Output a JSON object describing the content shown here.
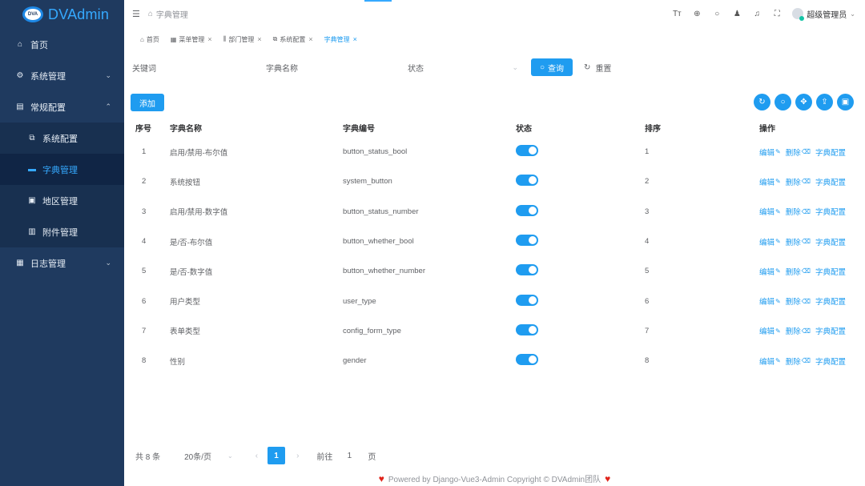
{
  "app": {
    "logo_badge": "DVA",
    "name": "DVAdmin"
  },
  "sidebar": {
    "items": [
      {
        "label": "首页",
        "icon": "home-icon",
        "glyph": "⌂",
        "level": 1
      },
      {
        "label": "系统管理",
        "icon": "gear-icon",
        "glyph": "⚙",
        "level": 1,
        "arrow": "⌄"
      },
      {
        "label": "常规配置",
        "icon": "config-icon",
        "glyph": "▤",
        "level": 1,
        "arrow": "⌃"
      },
      {
        "label": "系统配置",
        "icon": "system-config-icon",
        "glyph": "⧉",
        "level": 2
      },
      {
        "label": "字典管理",
        "icon": "dictionary-icon",
        "glyph": "▬",
        "level": 2,
        "active": true
      },
      {
        "label": "地区管理",
        "icon": "region-icon",
        "glyph": "▣",
        "level": 2
      },
      {
        "label": "附件管理",
        "icon": "attachment-icon",
        "glyph": "▥",
        "level": 2
      },
      {
        "label": "日志管理",
        "icon": "log-icon",
        "glyph": "▦",
        "level": 1,
        "arrow": "⌄"
      }
    ]
  },
  "header": {
    "breadcrumb": "字典管理",
    "user_name": "超级管理员",
    "icons": [
      "font-size-icon",
      "language-icon",
      "search-icon",
      "theme-icon",
      "notification-icon",
      "fullscreen-icon"
    ]
  },
  "tabs": [
    {
      "label": "首页",
      "icon": "home-icon",
      "closable": false
    },
    {
      "label": "菜单管理",
      "icon": "menu-icon",
      "closable": true
    },
    {
      "label": "部门管理",
      "icon": "department-icon",
      "closable": true
    },
    {
      "label": "系统配置",
      "icon": "system-config-icon",
      "closable": true
    },
    {
      "label": "字典管理",
      "icon": "",
      "closable": true,
      "active": true
    }
  ],
  "search": {
    "keyword_label": "关键词",
    "name_label": "字典名称",
    "status_label": "状态",
    "query_button": "查询",
    "reset_button": "重置"
  },
  "toolbar": {
    "add_button": "添加"
  },
  "table": {
    "columns": [
      "序号",
      "字典名称",
      "字典编号",
      "状态",
      "排序",
      "操作"
    ],
    "ops": {
      "edit": "编辑",
      "delete": "删除",
      "config": "字典配置"
    },
    "rows": [
      {
        "index": "1",
        "name": "启用/禁用-布尔值",
        "code": "button_status_bool",
        "sort": "1"
      },
      {
        "index": "2",
        "name": "系统按钮",
        "code": "system_button",
        "sort": "2"
      },
      {
        "index": "3",
        "name": "启用/禁用-数字值",
        "code": "button_status_number",
        "sort": "3"
      },
      {
        "index": "4",
        "name": "是/否-布尔值",
        "code": "button_whether_bool",
        "sort": "4"
      },
      {
        "index": "5",
        "name": "是/否-数字值",
        "code": "button_whether_number",
        "sort": "5"
      },
      {
        "index": "6",
        "name": "用户类型",
        "code": "user_type",
        "sort": "6"
      },
      {
        "index": "7",
        "name": "表单类型",
        "code": "config_form_type",
        "sort": "7"
      },
      {
        "index": "8",
        "name": "性别",
        "code": "gender",
        "sort": "8"
      }
    ]
  },
  "pagination": {
    "total": "共 8 条",
    "page_size": "20条/页",
    "current": "1",
    "goto_label": "前往",
    "goto_value": "1",
    "goto_unit": "页"
  },
  "footer": {
    "text": "Powered by Django-Vue3-Admin Copyright © DVAdmin团队"
  },
  "colors": {
    "sidebar": "#1f3a5f",
    "primary": "#1f9cf0",
    "active_menu": "#102545"
  }
}
